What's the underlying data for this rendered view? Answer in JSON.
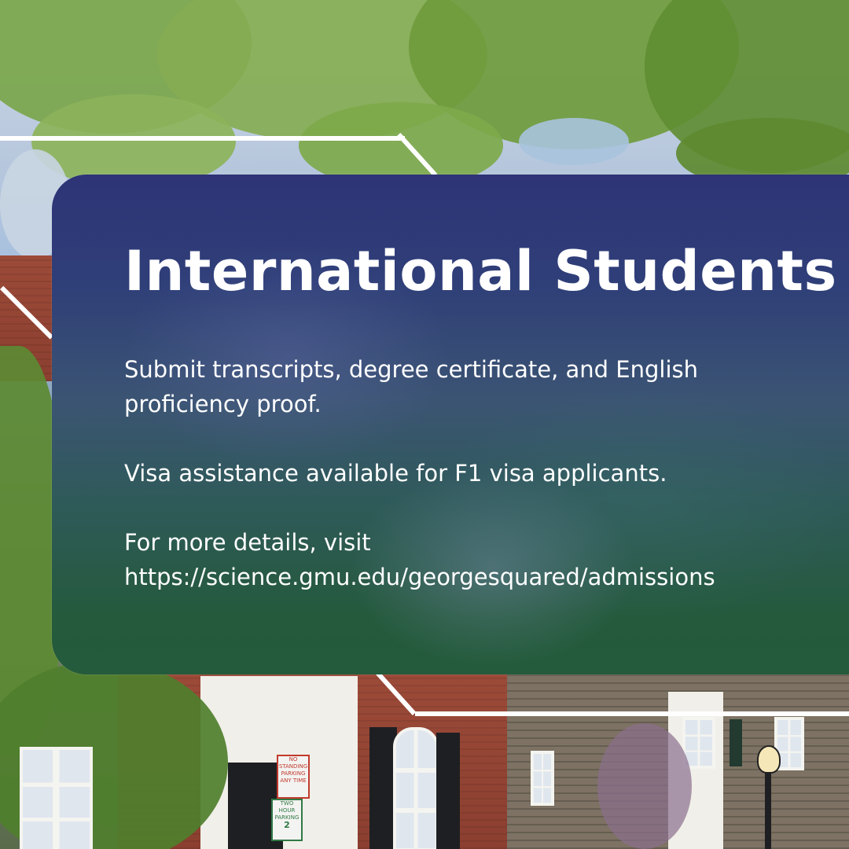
{
  "title": "International Students",
  "paragraphs": {
    "requirements": "Submit transcripts, degree certificate, and English proficiency proof.",
    "visa": "Visa assistance available for F1 visa applicants.",
    "details_intro": "For more details, visit",
    "details_url": "https://science.gmu.edu/georgesquared/admissions"
  },
  "signs": {
    "no_standing": "NO STANDING PARKING ANY TIME",
    "two_hour": "TWO HOUR PARKING",
    "zone": "2"
  },
  "colors": {
    "card_top": "#2e3477",
    "card_bottom": "#245b3c",
    "text": "#ffffff",
    "brick": "#9c4a38",
    "foliage": "#6c9a3a"
  }
}
